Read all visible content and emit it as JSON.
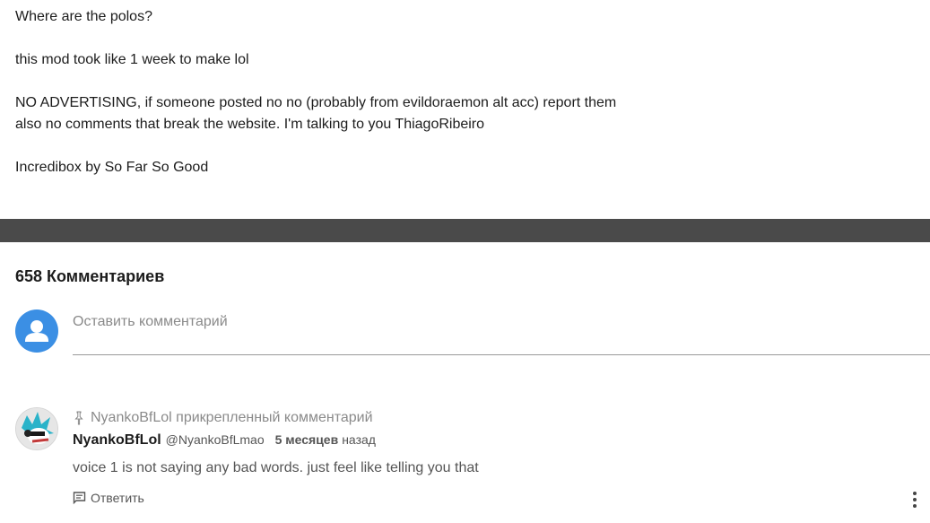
{
  "description": {
    "lines": [
      "Where are the polos?",
      "this mod took like 1 week to make lol",
      "NO ADVERTISING, if someone posted no no (probably from evildoraemon alt acc) report them",
      "also no comments that break the website. I'm talking to you ThiagoRibeiro",
      "Incredibox by So Far So Good"
    ]
  },
  "comments": {
    "count_label": "658 Комментариев",
    "input_placeholder": "Оставить комментарий",
    "items": [
      {
        "pinned_label": "NyankoBfLol прикрепленный комментарий",
        "author": "NyankoBfLol",
        "handle": "@NyankoBfLmao",
        "time": "5 месяцев",
        "time_suffix": "назад",
        "text": "voice 1 is not saying any bad words. just feel like telling you that",
        "reply_label": "Ответить"
      }
    ]
  },
  "colors": {
    "accent": "#3b8fe4",
    "divider": "#4a4a4a",
    "muted": "#8a8a8a"
  },
  "icons": {
    "user_avatar": "user-icon",
    "pin": "pin-icon",
    "reply": "reply-icon",
    "more": "more-vertical-icon"
  }
}
